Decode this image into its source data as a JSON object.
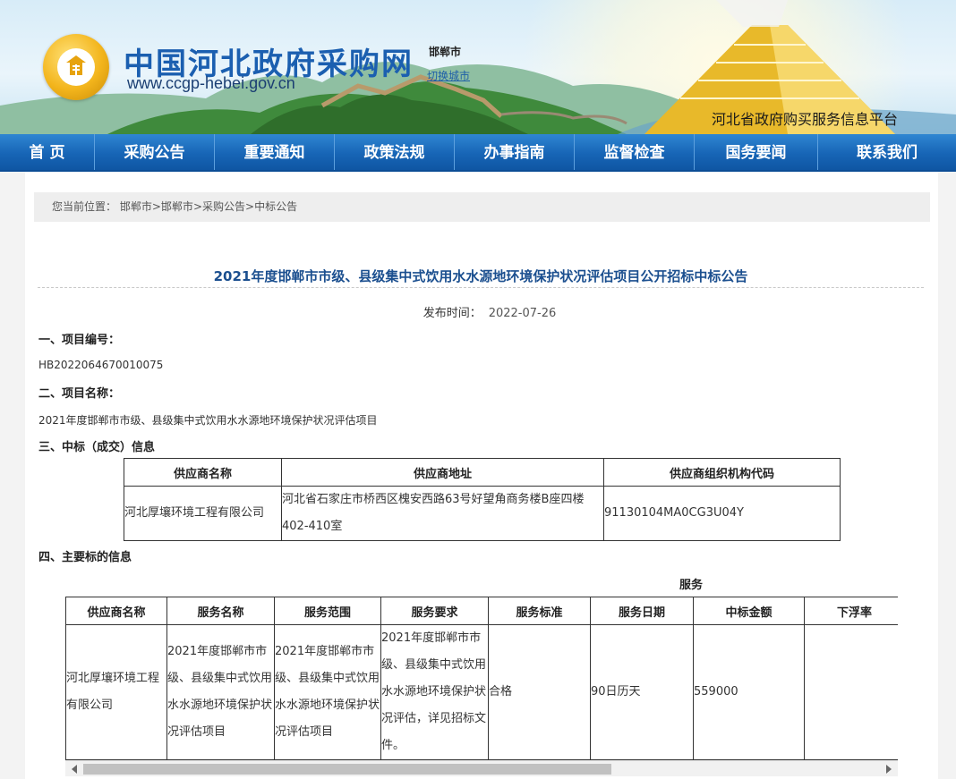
{
  "header": {
    "site_title": "中国河北政府采购网",
    "site_url": "www.ccgp-hebei.gov.cn",
    "city": "邯郸市",
    "switch_city": "切换城市",
    "platform": "河北省政府购买服务信息平台"
  },
  "nav": {
    "items": [
      {
        "label": "首 页"
      },
      {
        "label": "采购公告"
      },
      {
        "label": "重要通知"
      },
      {
        "label": "政策法规"
      },
      {
        "label": "办事指南"
      },
      {
        "label": "监督检查"
      },
      {
        "label": "国务要闻"
      },
      {
        "label": "联系我们"
      }
    ]
  },
  "breadcrumb": {
    "prefix": "您当前位置：",
    "items": [
      "邯郸市",
      "邯郸市",
      "采购公告",
      "中标公告"
    ],
    "separator": ">"
  },
  "notice": {
    "title": "2021年度邯郸市市级、县级集中式饮用水水源地环境保护状况评估项目公开招标中标公告",
    "publish_label": "发布时间：",
    "publish_date": "2022-07-26",
    "sec1_head": "一、项目编号：",
    "project_no": "HB2022064670010075",
    "sec2_head": "二、项目名称：",
    "project_name": "2021年度邯郸市市级、县级集中式饮用水水源地环境保护状况评估项目",
    "sec3_head": "三、中标（成交）信息",
    "sec4_head": "四、主要标的信息",
    "service_label": "服务"
  },
  "winner_table": {
    "headers": [
      "供应商名称",
      "供应商地址",
      "供应商组织机构代码"
    ],
    "row": [
      "河北厚壤环境工程有限公司",
      "河北省石家庄市桥西区槐安西路63号好望角商务楼B座四楼402-410室",
      "91130104MA0CG3U04Y"
    ]
  },
  "service_table": {
    "headers": [
      "供应商名称",
      "服务名称",
      "服务范围",
      "服务要求",
      "服务标准",
      "服务日期",
      "中标金额",
      "下浮率"
    ],
    "row": [
      "河北厚壤环境工程有限公司",
      "2021年度邯郸市市级、县级集中式饮用水水源地环境保护状况评估项目",
      "2021年度邯郸市市级、县级集中式饮用水水源地环境保护状况评估项目",
      "2021年度邯郸市市级、县级集中式饮用水水源地环境保护状况评估，详见招标文件。",
      "合格",
      "90日历天",
      "559000",
      ""
    ]
  },
  "colors": {
    "nav_blue": "#1765b6",
    "title_blue": "#1b4f8f",
    "logo_gold": "#f3b51c"
  }
}
